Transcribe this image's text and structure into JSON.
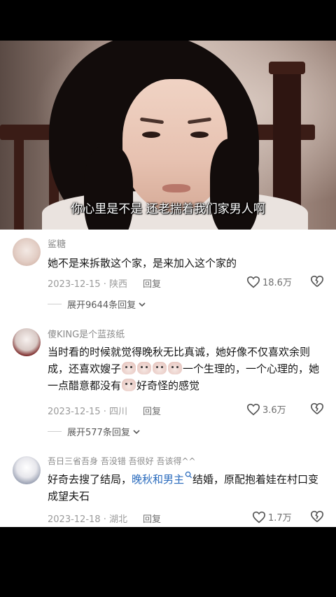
{
  "video": {
    "subtitle": "你心里是不是 还老揣着我们家男人啊"
  },
  "comments": [
    {
      "username": "鲨糖",
      "text": "她不是来拆散这个家，是来加入这个家的",
      "date": "2023-12-15",
      "location": "陕西",
      "reply_label": "回复",
      "likes": "18.6万",
      "expand_label": "展开9644条回复"
    },
    {
      "username": "傻KING是个蓝孩纸",
      "text_part1": "当时看的时候就觉得晚秋无比真诚，她好像不仅喜欢余则成，还喜欢嫂子",
      "text_part2": "一个生理的，一个心理的，她一点醋意都没有",
      "text_part3": "好奇怪的感觉",
      "date": "2023-12-15",
      "location": "四川",
      "reply_label": "回复",
      "likes": "3.6万",
      "expand_label": "展开577条回复"
    },
    {
      "username": "吾日三省吾身 吾没错 吾很好 吾该得^^",
      "text_part1": "好奇去搜了结局，",
      "keyword": "晚秋和男主",
      "text_part2": "结婚，原配抱着娃在村口变成望夫石",
      "date": "2023-12-18",
      "location": "湖北",
      "reply_label": "回复",
      "likes": "1.7万"
    }
  ],
  "icons": {
    "like": "heart-outline-icon",
    "dislike": "broken-heart-icon",
    "expand": "chevron-down-icon",
    "search": "search-icon"
  },
  "colors": {
    "keyword": "#2a6bbd",
    "meta": "#9a9a9a",
    "text": "#161616"
  }
}
